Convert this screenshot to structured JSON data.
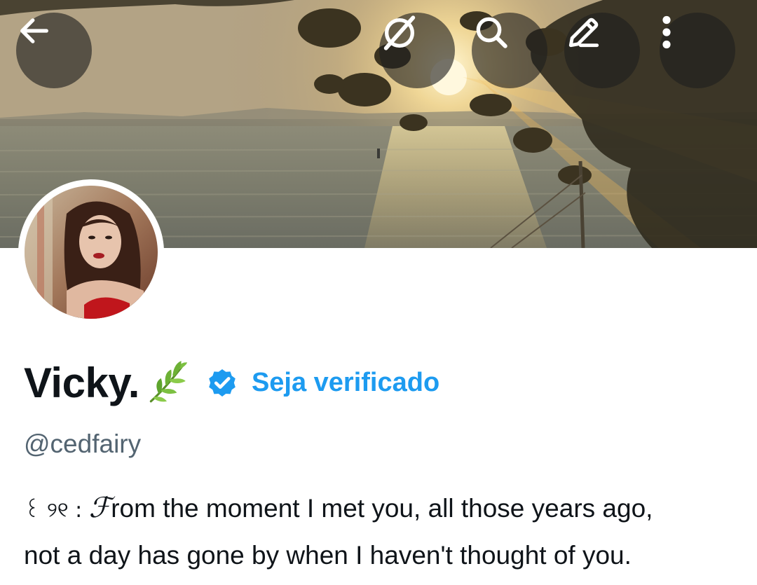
{
  "header": {
    "back_icon": "arrow-left-icon",
    "grok_icon": "grok-icon",
    "search_icon": "search-icon",
    "edit_icon": "pencil-icon",
    "more_icon": "more-vertical-icon"
  },
  "profile": {
    "display_name": "Vicky.",
    "name_emoji": "herb-emoji",
    "verified_icon": "verified-badge-icon",
    "get_verified_label": "Seja verificado",
    "handle": "@cedfairy",
    "bio": {
      "prefix": "꒰ ୨୧ : ",
      "script_letter": "ℱ",
      "rest_line1": "rom the moment I met you, all those years ago,",
      "line2": "not a day has gone by when I haven't thought of you."
    }
  },
  "colors": {
    "accent": "#1d9bf0",
    "text_primary": "#0f1419",
    "text_secondary": "#536471"
  }
}
